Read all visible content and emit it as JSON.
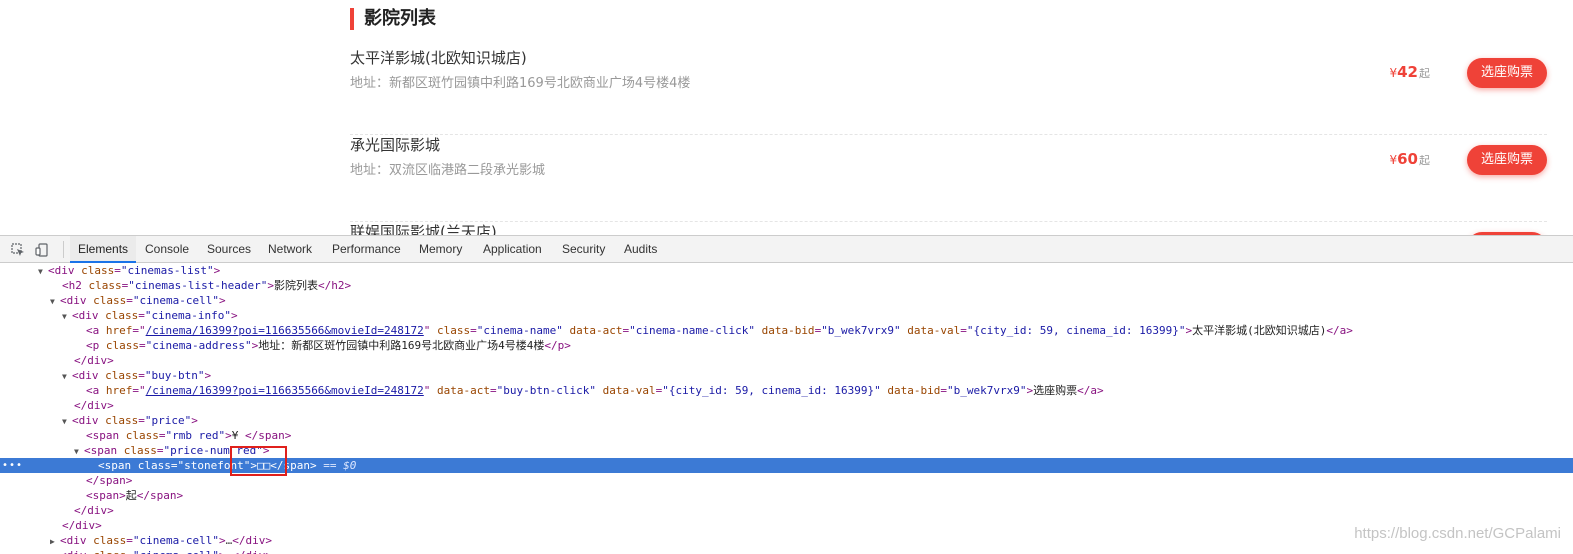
{
  "page": {
    "header": "影院列表",
    "cinemas": [
      {
        "name": "太平洋影城(北欧知识城店)",
        "address": "地址：新都区斑竹园镇中利路169号北欧商业广场4号楼4楼",
        "rmb": "¥",
        "price": "42",
        "qi": "起",
        "button": "选座购票"
      },
      {
        "name": "承光国际影城",
        "address": "地址：双流区临港路二段承光影城",
        "rmb": "¥",
        "price": "60",
        "qi": "起",
        "button": "选座购票"
      },
      {
        "name": "联娱国际影城(兰天店)",
        "address": "",
        "rmb": "",
        "price": "",
        "qi": "",
        "button": ""
      }
    ]
  },
  "devtools": {
    "tabs": [
      "Elements",
      "Console",
      "Sources",
      "Network",
      "Performance",
      "Memory",
      "Application",
      "Security",
      "Audits"
    ],
    "active_tab": "Elements",
    "selected_suffix": "== $0",
    "watermark": "https://blog.csdn.net/GCPalami",
    "s": {
      "div": "div",
      "h2": "h2",
      "a": "a",
      "p": "p",
      "span": "span",
      "class": "class",
      "href": "href",
      "data_act": "data-act",
      "data_bid": "data-bid",
      "data_val": "data-val",
      "cinemas_list": "\"cinemas-list\"",
      "cinemas_list_header": "\"cinemas-list-header\"",
      "cinema_cell": "\"cinema-cell\"",
      "cinema_info": "\"cinema-info\"",
      "href1": "/cinema/16399?poi=116635566&movieId=248172",
      "cinema_name": "\"cinema-name\"",
      "name_click": "\"cinema-name-click\"",
      "bid": "\"b_wek7vrx9\"",
      "val": "\"{city_id: 59, cinema_id: 16399}\"",
      "cinema_address": "\"cinema-address\"",
      "buy_btn": "\"buy-btn\"",
      "buy_click": "\"buy-btn-click\"",
      "price": "\"price\"",
      "rmb_red": "\"rmb red\"",
      "price_num_red": "\"price-num red\"",
      "stonefont": "\"stonefont\"",
      "stone_text": "□□",
      "header_text": "影院列表",
      "name_text": "太平洋影城(北欧知识城店)",
      "address_text": "地址：新都区斑竹园镇中利路169号北欧商业广场4号楼4楼",
      "buy_text": "选座购票",
      "rmb_text": "¥ ",
      "qi_text": "起",
      "ellipsis": "…"
    }
  }
}
